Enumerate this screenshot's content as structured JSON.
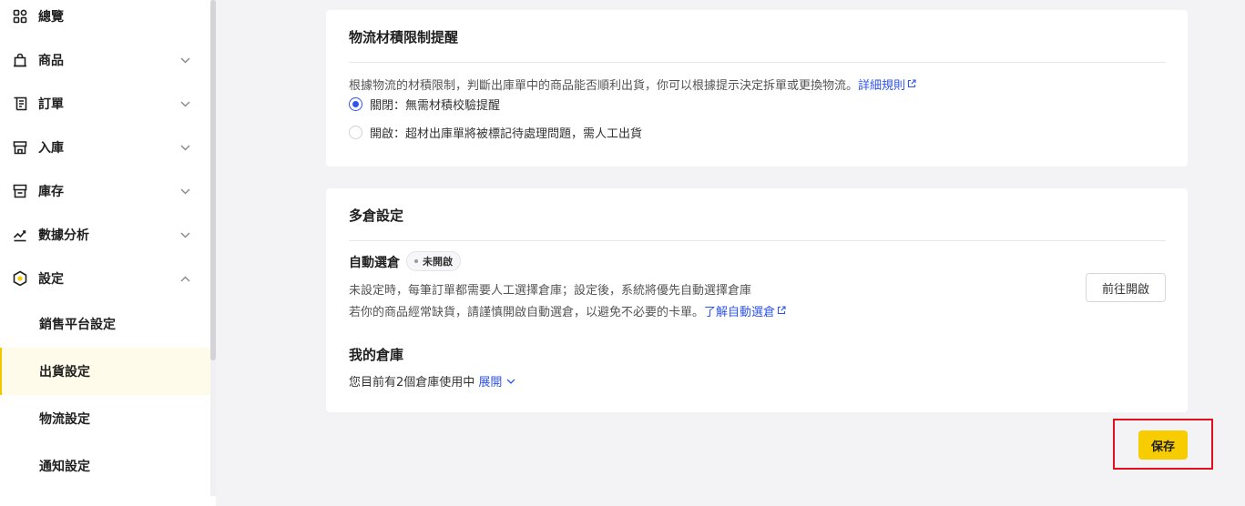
{
  "sidebar": {
    "items": [
      {
        "label": "總覽",
        "icon": "overview-icon"
      },
      {
        "label": "商品",
        "icon": "product-bag-icon"
      },
      {
        "label": "訂單",
        "icon": "order-icon"
      },
      {
        "label": "入庫",
        "icon": "inbound-store-icon"
      },
      {
        "label": "庫存",
        "icon": "inventory-icon"
      },
      {
        "label": "數據分析",
        "icon": "analytics-chart-icon"
      },
      {
        "label": "設定",
        "icon": "settings-hexagon-icon"
      }
    ],
    "sub_items": [
      {
        "label": "銷售平台設定"
      },
      {
        "label": "出貨設定",
        "active": true
      },
      {
        "label": "物流設定"
      },
      {
        "label": "通知設定"
      }
    ]
  },
  "logistics_card": {
    "title": "物流材積限制提醒",
    "description": "根據物流的材積限制，判斷出庫單中的商品能否順利出貨，你可以根據提示決定拆單或更換物流。",
    "rules_link": "詳細規則",
    "options": [
      {
        "label": "關閉：無需材積校驗提醒",
        "checked": true
      },
      {
        "label": "開啟：超材出庫單將被標記待處理問題，需人工出貨",
        "checked": false
      }
    ]
  },
  "warehouse_card": {
    "title": "多倉設定",
    "auto_select": {
      "title": "自動選倉",
      "badge": "未開啟",
      "line1": "未設定時，每筆訂單都需要人工選擇倉庫；設定後，系統將優先自動選擇倉庫",
      "line2": "若你的商品經常缺貨，請謹慎開啟自動選倉，以避免不必要的卡單。",
      "learn_link": "了解自動選倉",
      "button": "前往開啟"
    },
    "my_warehouses": {
      "title": "我的倉庫",
      "text": "您目前有2個倉庫使用中",
      "expand": "展開"
    }
  },
  "footer": {
    "save_label": "保存"
  },
  "colors": {
    "accent": "#f7cc00",
    "link": "#2f54eb",
    "highlight": "#e0101e"
  }
}
